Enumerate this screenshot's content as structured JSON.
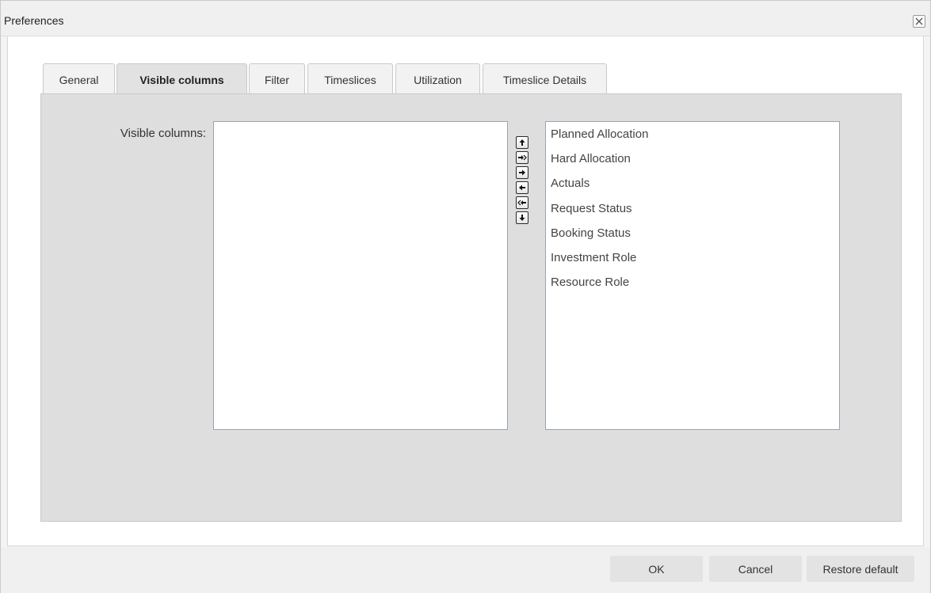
{
  "dialog": {
    "title": "Preferences"
  },
  "tabs": [
    {
      "label": "General",
      "active": false
    },
    {
      "label": "Visible columns",
      "active": true
    },
    {
      "label": "Filter",
      "active": false
    },
    {
      "label": "Timeslices",
      "active": false
    },
    {
      "label": "Utilization",
      "active": false
    },
    {
      "label": "Timeslice Details",
      "active": false
    }
  ],
  "panel": {
    "label": "Visible columns:",
    "visible_list": [],
    "available_list": [
      "Planned Allocation",
      "Hard Allocation",
      "Actuals",
      "Request Status",
      "Booking Status",
      "Investment Role",
      "Resource Role"
    ]
  },
  "arrow_icons": [
    "arrow-up-icon",
    "double-arrow-right-icon",
    "arrow-right-icon",
    "arrow-left-icon",
    "double-arrow-left-icon",
    "arrow-down-icon"
  ],
  "footer": {
    "ok_label": "OK",
    "cancel_label": "Cancel",
    "restore_label": "Restore default"
  }
}
